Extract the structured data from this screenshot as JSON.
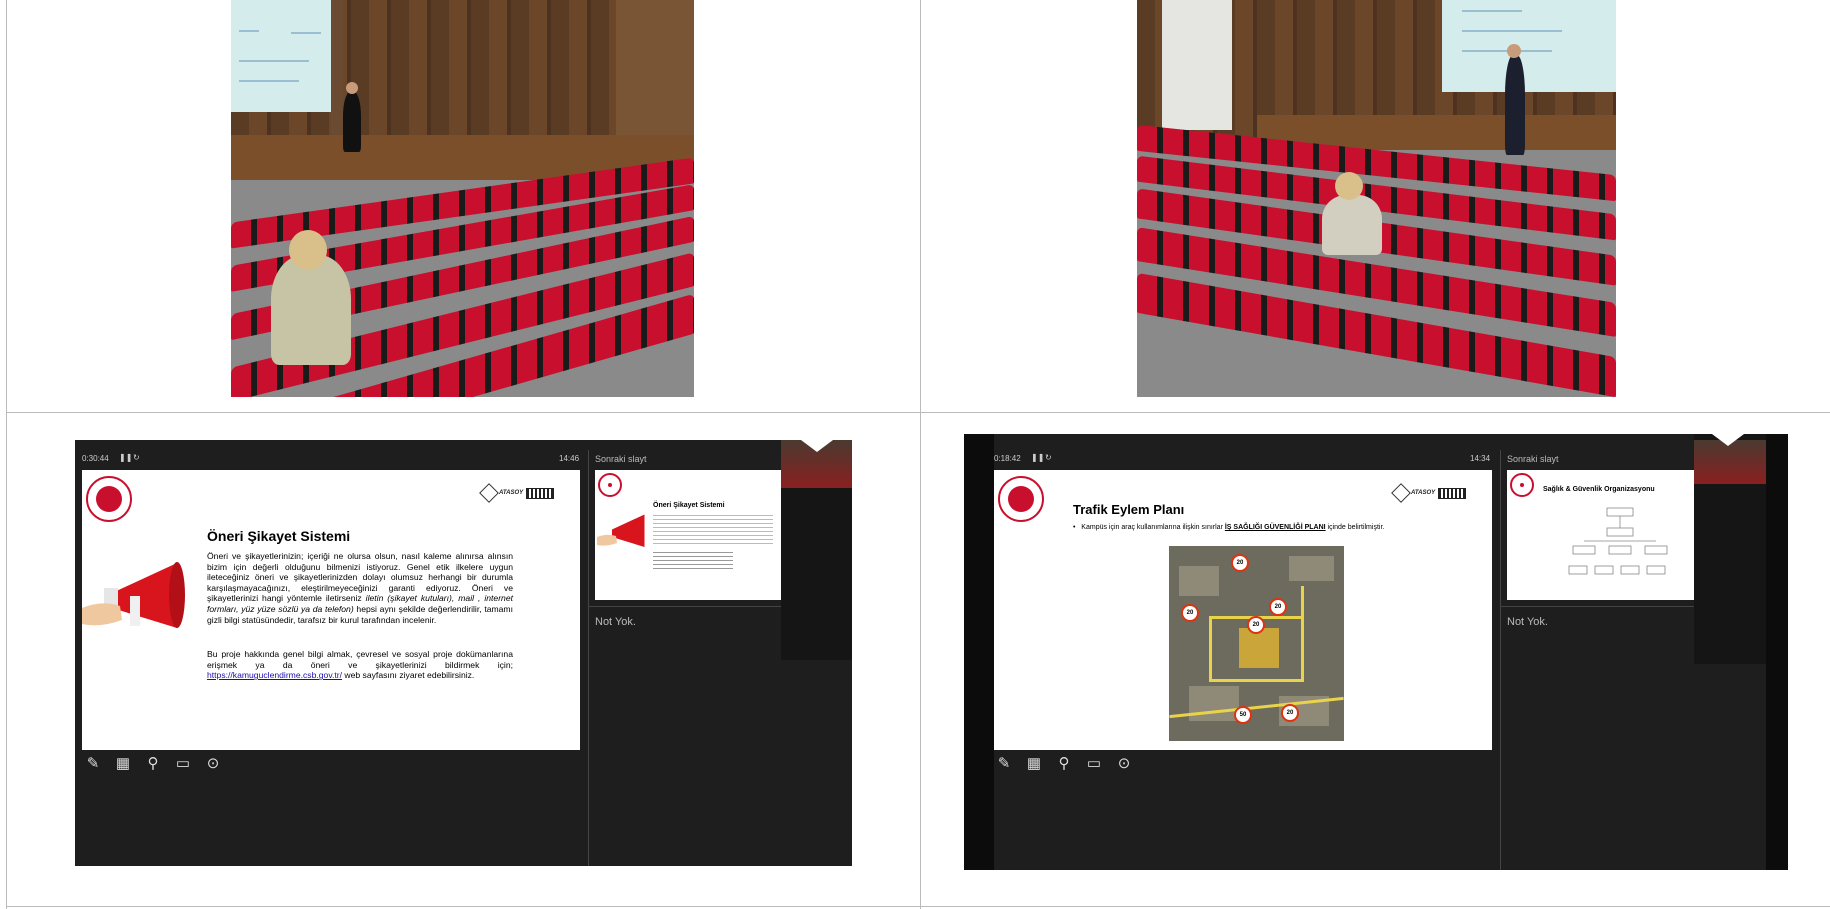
{
  "panels": [
    {
      "timer": "0:30:44",
      "clock": "14:46",
      "slide": {
        "title": "Öneri Şikayet Sistemi",
        "p1_a": "Öneri ve şikayetlerinizin; içeriği ne olursa olsun, nasıl kaleme alınırsa alınsın bizim için değerli olduğunu bilmenizi istiyoruz. Genel etik ilkelere uygun ileteceğiniz öneri ve şikayetlerinizden dolayı olumsuz herhangi bir durumla karşılaşmayacağınızı, eleştirilmeyeceğinizi garanti ediyoruz. Öneri ve şikayetlerinizi hangi yöntemle iletirseniz ",
        "p1_i": "iletin (şikayet kutuları), mail , internet formları, yüz yüze sözlü ya da telefon)",
        "p1_b": " hepsi aynı şekilde değerlendirilir, tamamı gizli bilgi statüsündedir, tarafsız bir kurul tarafından incelenir.",
        "p2_a": "Bu proje hakkında genel bilgi almak, çevresel ve sosyal proje dokümanlarına erişmek ya da öneri ve şikayetlerinizi bildirmek için; ",
        "p2_link": "https://kamuguclendirme.csb.gov.tr/",
        "p2_b": " web sayfasını ziyaret edebilirsiniz."
      },
      "next_label": "Sonraki slayt",
      "next_title": "Öneri Şikayet Sistemi",
      "notes": "Not Yok."
    },
    {
      "timer": "0:18:42",
      "clock": "14:34",
      "slide": {
        "title": "Trafik Eylem Planı",
        "bullet_a": "Kampüs için araç kullanımlarına ilişkin sınırlar ",
        "bullet_b": "İŞ SAĞLIĞI GÜVENLİĞİ PLANI",
        "bullet_c": " içinde belirtilmiştir.",
        "signs": [
          "20",
          "20",
          "20",
          "20",
          "50",
          "20"
        ]
      },
      "next_label": "Sonraki slayt",
      "next_title": "Sağlık & Güvenlik Organizasyonu",
      "notes": "Not Yok."
    }
  ],
  "brand": "ATASOY",
  "brand_code": "BOYTEK",
  "icons": [
    "pen-icon",
    "slides-grid-icon",
    "zoom-icon",
    "screen-icon",
    "more-options-icon"
  ],
  "colors": {
    "accent": "#c8102e",
    "presenter_bg": "#1e1e1e"
  }
}
